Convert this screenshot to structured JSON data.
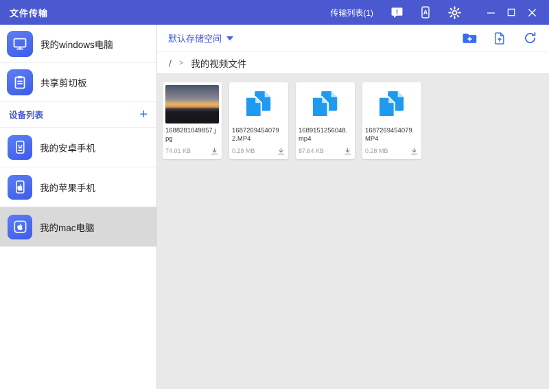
{
  "colors": {
    "titlebar": "#4a59cf",
    "accent_blue": "#3f5ce0",
    "sidebar_icon_blue": "#4a6af0",
    "file_icon_blue": "#1e9bf0",
    "content_bg": "#e9e9e9",
    "selected_item_bg": "#d9d9d9"
  },
  "titlebar": {
    "app_title": "文件传输",
    "transfer_list": "传输列表(1)"
  },
  "icons": {
    "feedback_mark": "!",
    "device_letter": "A"
  },
  "sidebar": {
    "computer_label": "我的windows电脑",
    "clipboard_label": "共享剪切板",
    "device_list_label": "设备列表",
    "add_device": "+",
    "devices": [
      {
        "label": "我的安卓手机",
        "type": "android",
        "selected": false
      },
      {
        "label": "我的苹果手机",
        "type": "iphone",
        "selected": false
      },
      {
        "label": "我的mac电脑",
        "type": "mac",
        "selected": true
      }
    ]
  },
  "toolbar": {
    "storage_selector": "默认存储空间"
  },
  "breadcrumb": {
    "root": "/",
    "separator": ">",
    "current": "我的视频文件"
  },
  "files": [
    {
      "name": "1688281049857.jpg",
      "size": "74.01 KB",
      "type": "image"
    },
    {
      "name": "1687269454079 2.MP4",
      "size": "0.28 MB",
      "type": "video"
    },
    {
      "name": "1689151256048.mp4",
      "size": "87.64 KB",
      "type": "video"
    },
    {
      "name": "1687269454079.MP4",
      "size": "0.28 MB",
      "type": "video"
    }
  ]
}
